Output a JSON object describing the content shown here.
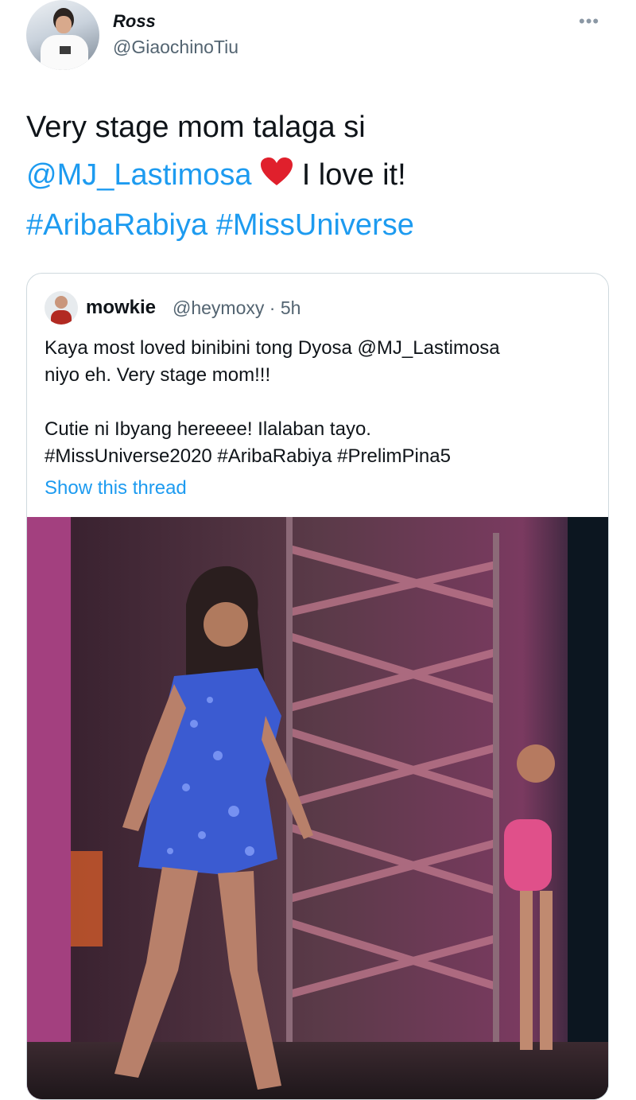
{
  "author": {
    "name": "Ross",
    "handle": "@GiaochinoTiu"
  },
  "more_label": "•••",
  "tweet": {
    "text_line1": "Very stage mom talaga si",
    "mention": "@MJ_Lastimosa",
    "after_mention": "I love it!",
    "hashtags": "#AribaRabiya #MissUniverse",
    "emoji": "heart"
  },
  "quoted": {
    "name": "mowkie",
    "handle_time": "@heymoxy · 5h",
    "text": "Kaya most loved binibini tong Dyosa @MJ_Lastimosa\nniyo eh. Very stage mom!!!\n\nCutie ni Ibyang hereeee! Ilalaban tayo.\n#MissUniverse2020 #AribaRabiya #PrelimPina5",
    "show_thread": "Show this thread"
  },
  "colors": {
    "link": "#1d9bf0",
    "secondary": "#536471",
    "border": "#cfd9de"
  },
  "icons": [
    "more-dots-icon",
    "heart-emoji-icon"
  ]
}
